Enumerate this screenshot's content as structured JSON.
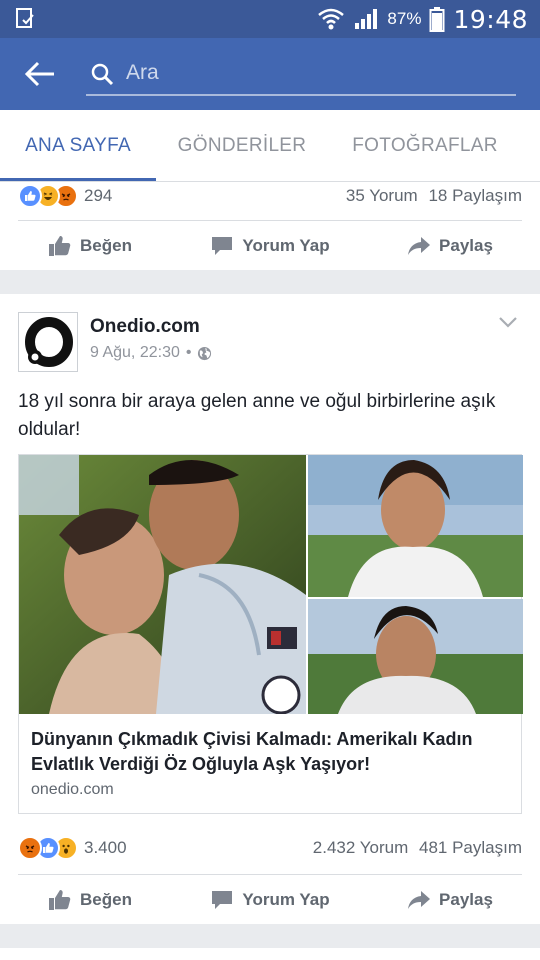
{
  "status_bar": {
    "battery_percent": "87%",
    "time": "19:48"
  },
  "search": {
    "placeholder": "Ara"
  },
  "tabs": [
    {
      "label": "ANA SAYFA",
      "active": true
    },
    {
      "label": "GÖNDERİLER",
      "active": false
    },
    {
      "label": "FOTOĞRAFLAR",
      "active": false
    }
  ],
  "top_post": {
    "reaction_count": "294",
    "comments": "35 Yorum",
    "shares": "18 Paylaşım",
    "reactions": [
      "like",
      "haha",
      "angry"
    ]
  },
  "actions": {
    "like": "Beğen",
    "comment": "Yorum Yap",
    "share": "Paylaş"
  },
  "post": {
    "author": "Onedio.com",
    "date": "9 Ağu, 22:30",
    "separator": "•",
    "privacy_icon": "globe-icon",
    "text": "18 yıl sonra bir araya gelen anne ve oğul birbirlerine aşık oldular!",
    "link": {
      "title": "Dünyanın Çıkmadık Çivisi Kalmadı: Amerikalı Kadın Evlatlık Verdiği Öz Oğluyla Aşk Yaşıyor!",
      "domain": "onedio.com"
    },
    "reaction_count": "3.400",
    "comments": "2.432 Yorum",
    "shares": "481 Paylaşım",
    "reactions": [
      "angry",
      "like",
      "wow"
    ]
  },
  "colors": {
    "brand": "#3b5998",
    "header": "#4267b2",
    "like": "#5890ff",
    "angry": "#e9710f",
    "haha": "#f7b125"
  }
}
